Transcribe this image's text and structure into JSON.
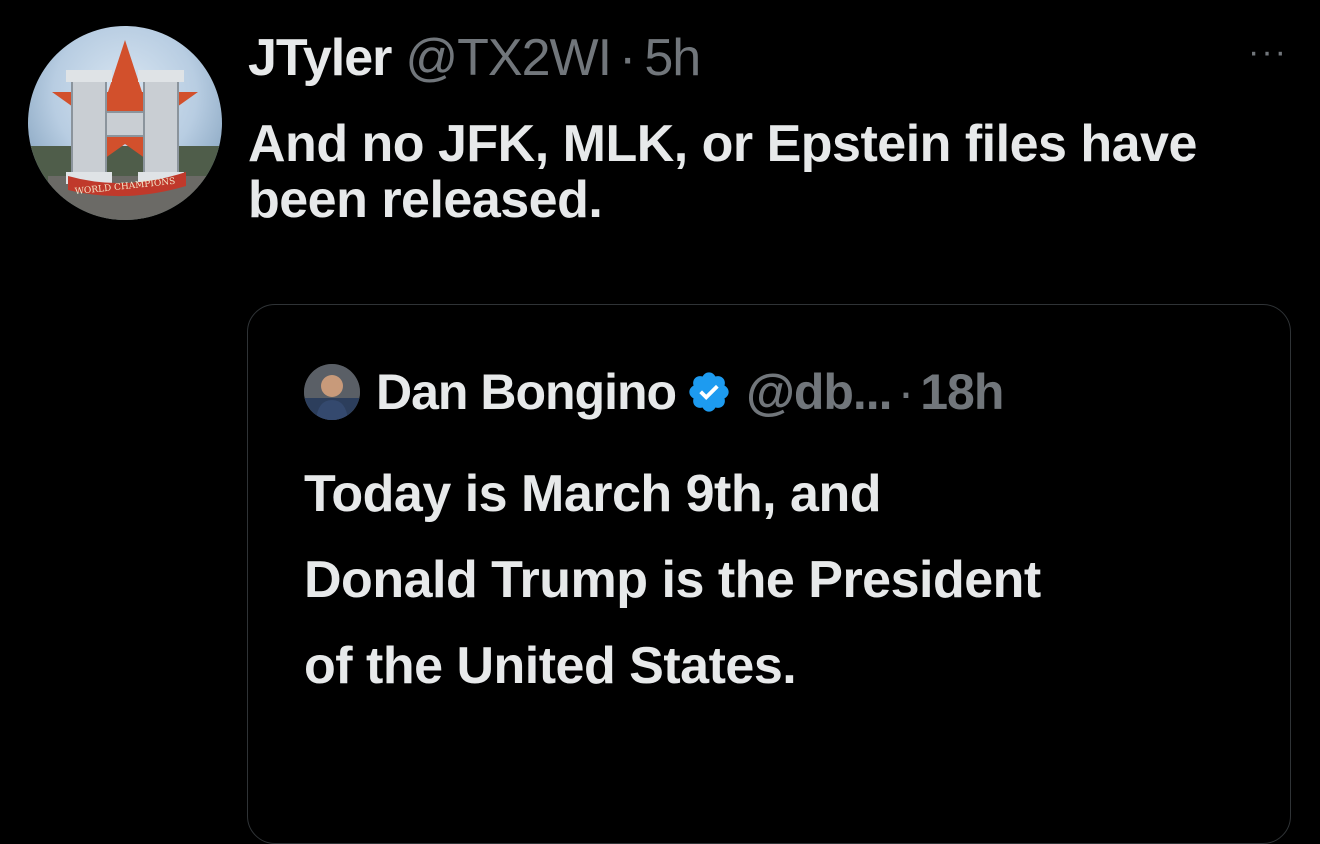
{
  "tweet": {
    "author": {
      "display_name": "JTyler",
      "handle": "@TX2WI",
      "avatar_icon": "houston-astros-h-logo-avatar",
      "avatar_caption": "WORLD CHAMPIONS"
    },
    "separator": "·",
    "time": "5h",
    "more_label": "···",
    "text": "And no JFK, MLK, or Epstein files have been released."
  },
  "quoted_tweet": {
    "author": {
      "display_name": "Dan Bongino",
      "handle": "@db...",
      "avatar_icon": "person-avatar",
      "verified_icon": "verified-badge-icon"
    },
    "separator": "·",
    "time": "18h",
    "text": "Today is March 9th, and Donald Trump is the President of the United States."
  },
  "colors": {
    "background": "#000000",
    "primary_text": "#e7e9ea",
    "secondary_text": "#71767b",
    "border": "#2f3336",
    "verified": "#1d9bf0"
  }
}
